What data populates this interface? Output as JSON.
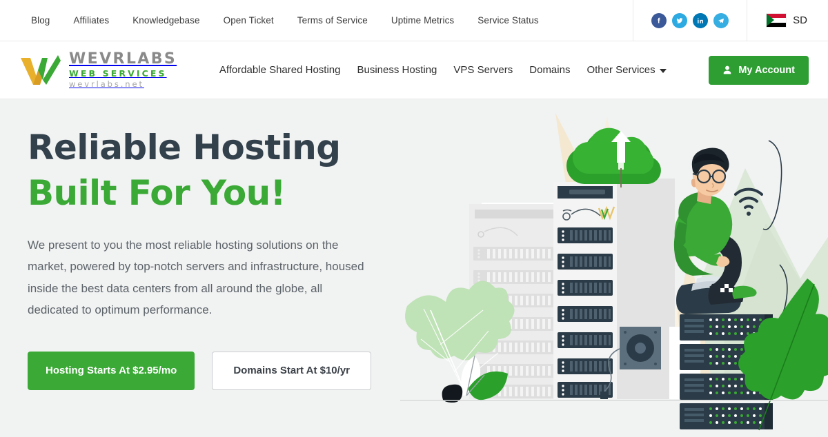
{
  "topbar": {
    "links": [
      {
        "label": "Blog",
        "name": "topnav-blog"
      },
      {
        "label": "Affiliates",
        "name": "topnav-affiliates"
      },
      {
        "label": "Knowledgebase",
        "name": "topnav-knowledgebase"
      },
      {
        "label": "Open Ticket",
        "name": "topnav-open-ticket"
      },
      {
        "label": "Terms of Service",
        "name": "topnav-terms-of-service"
      },
      {
        "label": "Uptime Metrics",
        "name": "topnav-uptime-metrics"
      },
      {
        "label": "Service Status",
        "name": "topnav-service-status"
      }
    ],
    "social": [
      {
        "icon": "facebook-icon",
        "color": "#3b5998"
      },
      {
        "icon": "twitter-icon",
        "color": "#2daae1"
      },
      {
        "icon": "linkedin-icon",
        "color": "#0077b5"
      },
      {
        "icon": "telegram-icon",
        "color": "#37aee2"
      }
    ],
    "country": {
      "flag": "sudan-flag-icon",
      "code": "SD"
    }
  },
  "header": {
    "logo": {
      "line1": "WEVRLABS",
      "line2": "WEB SERVICES",
      "line3": "wevrlabs.net",
      "mark_colors": {
        "left": "#e8b02b",
        "right": "#3aa935"
      }
    },
    "nav": [
      {
        "label": "Affordable Shared Hosting",
        "name": "nav-affordable-shared-hosting",
        "caret": false
      },
      {
        "label": "Business Hosting",
        "name": "nav-business-hosting",
        "caret": false
      },
      {
        "label": "VPS Servers",
        "name": "nav-vps-servers",
        "caret": false
      },
      {
        "label": "Domains",
        "name": "nav-domains",
        "caret": false
      },
      {
        "label": "Other Services",
        "name": "nav-other-services",
        "caret": true
      }
    ],
    "account_button": {
      "label": "My Account",
      "icon": "user-icon",
      "color": "#2e9e33"
    }
  },
  "hero": {
    "title_line1": "Reliable Hosting",
    "title_line2": "Built For You!",
    "paragraph": "We present to you the most reliable hosting solutions on the market, powered by top-notch servers and infrastructure, housed inside the best data centers from all around the globe, all dedicated to optimum performance.",
    "cta_primary": "Hosting Starts At $2.95/mo",
    "cta_secondary": "Domains Start At $10/yr",
    "illustration": "cloud-hosting-servers-person-illustration"
  },
  "colors": {
    "brand_green": "#3aa935",
    "button_green": "#2e9e33",
    "heading_dark": "#33414c",
    "body_text": "#5c6369",
    "page_bg": "#f1f2f2",
    "server_dark": "#2b3b47",
    "mountain_green": "#dbe7d7",
    "beige": "#f4e8d0"
  }
}
